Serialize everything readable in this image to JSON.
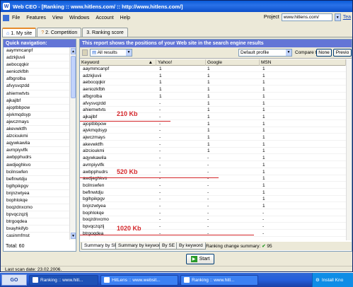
{
  "window": {
    "title": "Web CEO - [Ranking :: www.hitlens.com/ :: http://www.hitlens.com/]",
    "app_icon": "W"
  },
  "menu": {
    "items": [
      "File",
      "Features",
      "View",
      "Windows",
      "Account",
      "Help"
    ],
    "project_label": "Project",
    "project_value": "www.hitlens.com/",
    "help_link": "Tea"
  },
  "tabs": [
    {
      "label": "1. My site",
      "icon": "home-icon"
    },
    {
      "label": "2. Competition",
      "icon": "question-icon"
    },
    {
      "label": "3. Ranking score",
      "icon": ""
    }
  ],
  "left": {
    "header": "Quick navigation:",
    "items": [
      "aaymmcanpf",
      "adzkjluvii",
      "aebocqqkir",
      "aeniozkfbh",
      "afbgrolba",
      "afvysvqzdd",
      "ahiemwtvts",
      "ajkajlbf",
      "ajoptbbpow",
      "ajvkmqdsyp",
      "ajwczmays",
      "akevwktfh",
      "alzcioukmi",
      "aqywkawila",
      "avmpiyvlfk",
      "awbpphudrs",
      "awdjeghkvo",
      "bcilnswfen",
      "beflnwtdju",
      "bglhpikpgv",
      "bnjnzwtyea",
      "bophlokqe",
      "boqzdnxcmo",
      "bpvqczqzlj",
      "btrgoqdea",
      "bxayhkifyb",
      "casinmfmst"
    ],
    "total_label": "Total: 60"
  },
  "right": {
    "header": "This report shows the positions of your Web site in the search engine results",
    "filter_value": "All results",
    "profile_value": "Default profile",
    "compare_label": "Compare to:",
    "compare_none": "None",
    "compare_previous": "Previo",
    "columns": [
      "Keyword",
      "Yahoo!",
      "Google",
      "MSN"
    ],
    "rows": [
      {
        "kw": "aaymmcanpf",
        "y": "1",
        "g": "1",
        "m": "1"
      },
      {
        "kw": "adzkjluvii",
        "y": "1",
        "g": "1",
        "m": "1"
      },
      {
        "kw": "aebocqqkir",
        "y": "1",
        "g": "1",
        "m": "1"
      },
      {
        "kw": "aeniozkfbh",
        "y": "1",
        "g": "1",
        "m": "1"
      },
      {
        "kw": "afbgrolba",
        "y": "1",
        "g": "1",
        "m": "1"
      },
      {
        "kw": "afvysvqzdd",
        "y": "-",
        "g": "1",
        "m": "1"
      },
      {
        "kw": "ahiemwtvts",
        "y": "-",
        "g": "1",
        "m": "1"
      },
      {
        "kw": "ajkajlbf",
        "y": "-",
        "g": "1",
        "m": "1"
      },
      {
        "kw": "ajoptbbpow",
        "y": "-",
        "g": "1",
        "m": "1"
      },
      {
        "kw": "ajvkmqdsyp",
        "y": "-",
        "g": "1",
        "m": "1"
      },
      {
        "kw": "ajwczmays",
        "y": "-",
        "g": "1",
        "m": "1"
      },
      {
        "kw": "akevwktfh",
        "y": "-",
        "g": "1",
        "m": "1"
      },
      {
        "kw": "alzcioukmi",
        "y": "-",
        "g": "1",
        "m": "1"
      },
      {
        "kw": "aqywkawila",
        "y": "-",
        "g": "-",
        "m": "1"
      },
      {
        "kw": "avmpiyvlfk",
        "y": "-",
        "g": "-",
        "m": "1"
      },
      {
        "kw": "awbpphudrs",
        "y": "-",
        "g": "-",
        "m": "1"
      },
      {
        "kw": "awdjeghkvo",
        "y": "-",
        "g": "-",
        "m": "1"
      },
      {
        "kw": "bcilnswfen",
        "y": "-",
        "g": "-",
        "m": "1"
      },
      {
        "kw": "beflnwtdju",
        "y": "-",
        "g": "-",
        "m": "1"
      },
      {
        "kw": "bglhpikpgv",
        "y": "-",
        "g": "-",
        "m": "1"
      },
      {
        "kw": "bnjnzwtyea",
        "y": "-",
        "g": "-",
        "m": "1"
      },
      {
        "kw": "bophlokqe",
        "y": "-",
        "g": "-",
        "m": "-"
      },
      {
        "kw": "boqzdnxcmo",
        "y": "-",
        "g": "-",
        "m": "-"
      },
      {
        "kw": "bpvqczqzlj",
        "y": "-",
        "g": "-",
        "m": "-"
      },
      {
        "kw": "btrgoqdea",
        "y": "-",
        "g": "-",
        "m": "-"
      }
    ],
    "annotations": [
      "210 Kb",
      "520 Kb",
      "1020 Kb"
    ],
    "bottom_tabs": [
      "Summary by SE",
      "Summary by keyword",
      "By SE",
      "By keyword"
    ],
    "summary_label": "Ranking change summary:",
    "summary_value": "95",
    "start_label": "Start"
  },
  "status": {
    "text": "Last scan date: 23.02.2006."
  },
  "taskbar": {
    "go": "GO",
    "items": [
      "Ranking :: www.hitl...",
      "HitLens :: www.websit...",
      "Ranking :: www.hitl..."
    ],
    "tray": "Install Kno"
  },
  "colors": {
    "accent_header": "#6375d6",
    "annotation_red": "#d4262a",
    "title_blue": "#0a5bd8"
  }
}
